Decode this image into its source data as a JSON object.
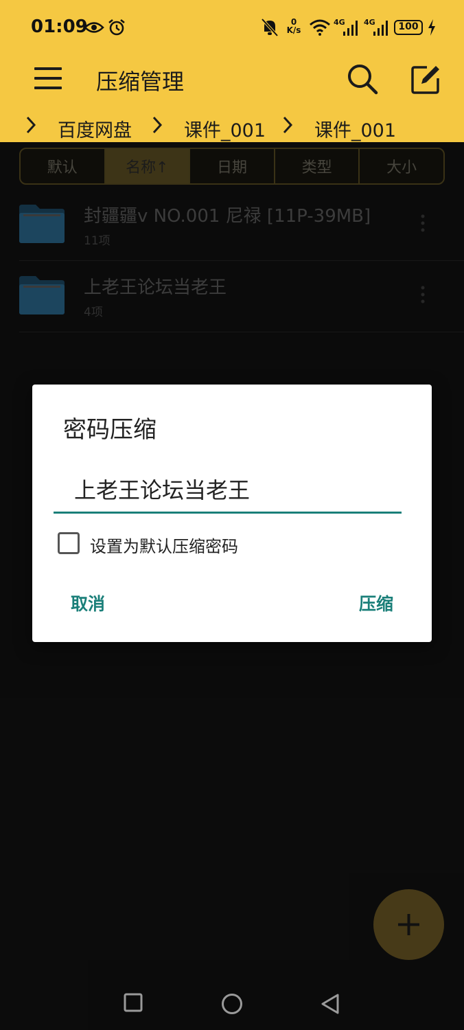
{
  "status_bar": {
    "time": "01:09",
    "net_speed_top": "0",
    "net_speed_bottom": "K/s",
    "sim1_label": "4G",
    "sim2_label": "4G",
    "battery": "100"
  },
  "app_bar": {
    "title": "压缩管理"
  },
  "breadcrumbs": [
    "百度网盘",
    "课件_001",
    "课件_001"
  ],
  "sort_tabs": [
    "默认",
    "名称↑",
    "日期",
    "类型",
    "大小"
  ],
  "files": [
    {
      "name": "封疆疆v NO.001 尼禄 [11P-39MB]",
      "meta": "11项"
    },
    {
      "name": "上老王论坛当老王",
      "meta": "4项"
    }
  ],
  "dialog": {
    "title": "密码压缩",
    "input_value": "上老王论坛当老王",
    "checkbox_label": "设置为默认压缩密码",
    "cancel_label": "取消",
    "confirm_label": "压缩"
  },
  "colors": {
    "header": "#f5c842",
    "accent_teal": "#1a7f79",
    "fab": "#6e5a25",
    "folder": "#2b6a91"
  }
}
